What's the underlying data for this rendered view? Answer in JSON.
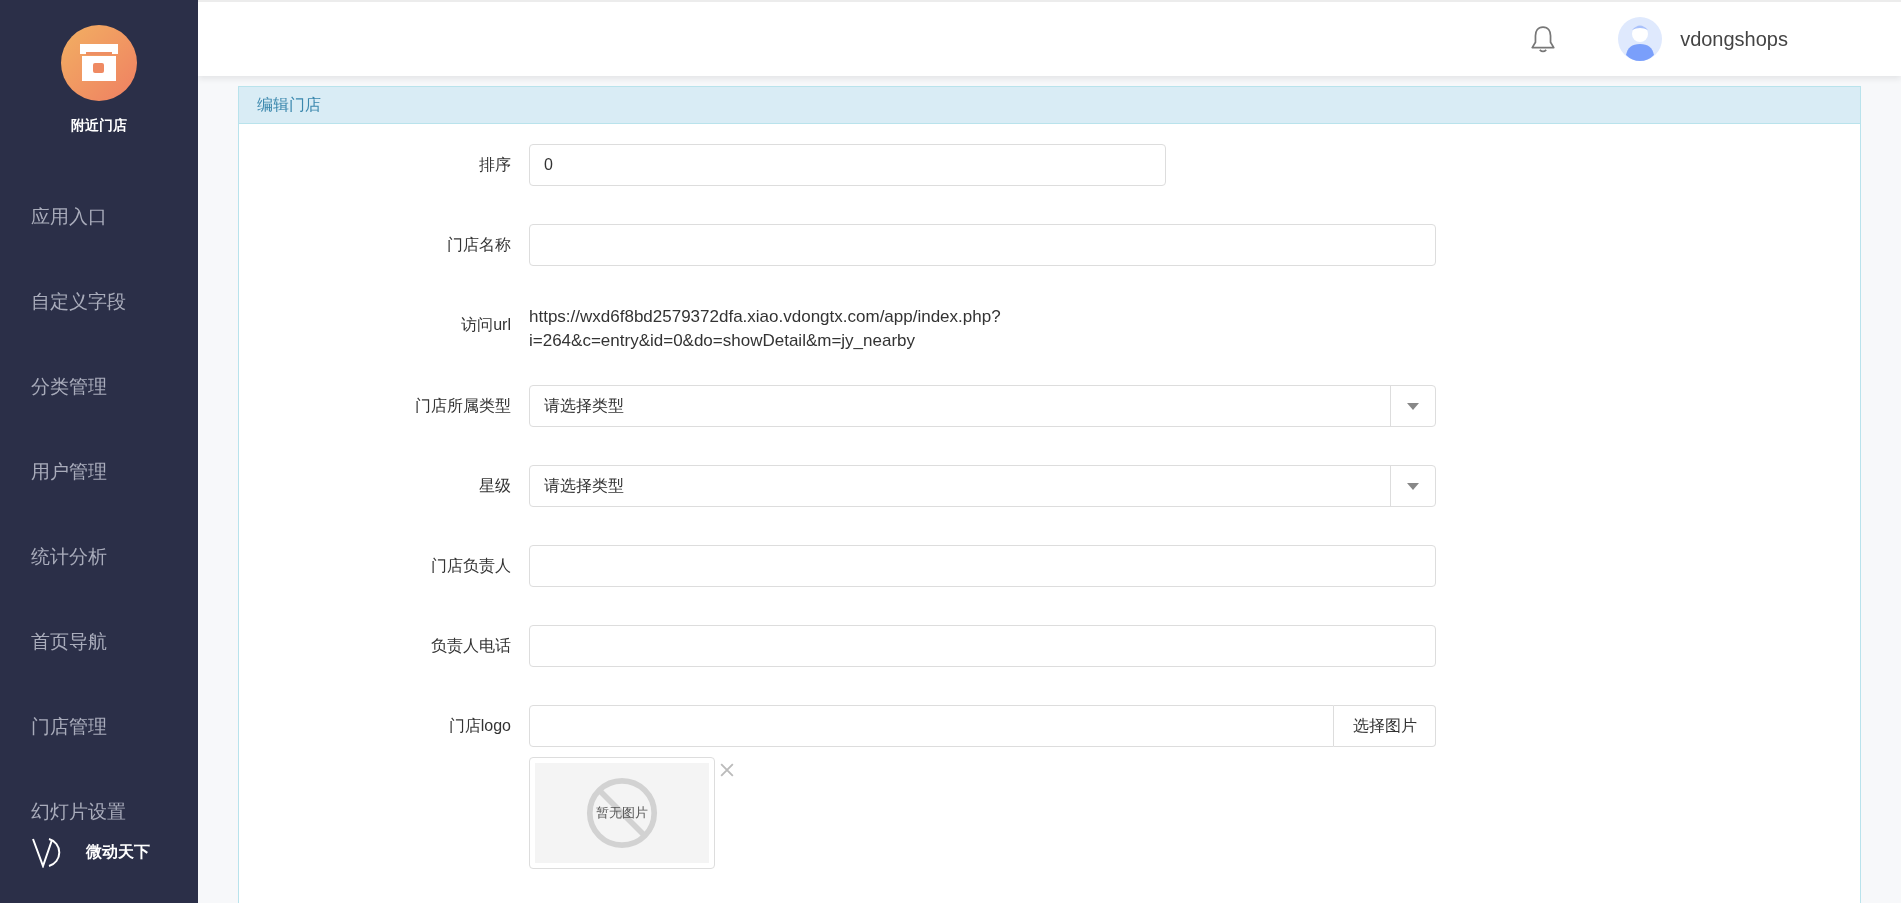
{
  "sidebar": {
    "app_name": "附近门店",
    "items": [
      {
        "label": "应用入口"
      },
      {
        "label": "自定义字段"
      },
      {
        "label": "分类管理"
      },
      {
        "label": "用户管理"
      },
      {
        "label": "统计分析"
      },
      {
        "label": "首页导航"
      },
      {
        "label": "门店管理"
      },
      {
        "label": "幻灯片设置"
      }
    ],
    "brand": "微动天下"
  },
  "header": {
    "username": "vdongshops"
  },
  "panel": {
    "title": "编辑门店",
    "fields": [
      {
        "kind": "short_text",
        "label": "排序",
        "value": "0"
      },
      {
        "kind": "text",
        "label": "门店名称"
      },
      {
        "kind": "static",
        "label": "访问url",
        "lines": [
          "https://wxd6f8bd2579372dfa.xiao.vdongtx.com/app/index.php?",
          "i=264&c=entry&id=0&do=showDetail&m=jy_nearby"
        ]
      },
      {
        "kind": "select",
        "label": "门店所属类型",
        "value": "请选择类型"
      },
      {
        "kind": "select",
        "label": "星级",
        "value": "请选择类型"
      },
      {
        "kind": "text",
        "label": "门店负责人"
      },
      {
        "kind": "text",
        "label": "负责人电话"
      },
      {
        "kind": "image",
        "label": "门店logo",
        "button": "选择图片",
        "preview": "暂无图片"
      }
    ]
  }
}
